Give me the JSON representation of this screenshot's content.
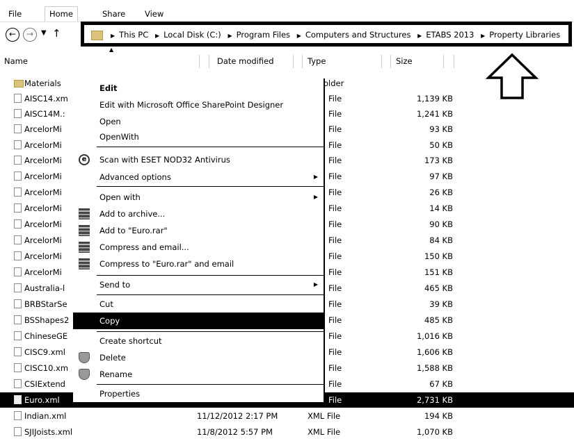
{
  "ribbon": {
    "tabs": [
      "File",
      "Home",
      "Share",
      "View"
    ]
  },
  "address": {
    "crumbs": [
      "This PC",
      "Local Disk (C:)",
      "Program Files",
      "Computers and Structures",
      "ETABS 2013",
      "Property Libraries"
    ]
  },
  "columns": {
    "name": "Name",
    "date": "Date modified",
    "type": "Type",
    "size": "Size"
  },
  "files": [
    {
      "name": "Materials",
      "date": "",
      "type": "older",
      "size": "",
      "folder": true
    },
    {
      "name": "AISC14.xm",
      "date": "",
      "type": "File",
      "size": "1,139 KB"
    },
    {
      "name": "AISC14M.:",
      "date": "",
      "type": "File",
      "size": "1,241 KB"
    },
    {
      "name": "ArcelorMi",
      "date": "",
      "type": "File",
      "size": "93 KB"
    },
    {
      "name": "ArcelorMi",
      "date": "",
      "type": "File",
      "size": "50 KB"
    },
    {
      "name": "ArcelorMi",
      "date": "",
      "type": "File",
      "size": "173 KB"
    },
    {
      "name": "ArcelorMi",
      "date": "",
      "type": "File",
      "size": "97 KB"
    },
    {
      "name": "ArcelorMi",
      "date": "",
      "type": "File",
      "size": "26 KB"
    },
    {
      "name": "ArcelorMi",
      "date": "",
      "type": "File",
      "size": "14 KB"
    },
    {
      "name": "ArcelorMi",
      "date": "",
      "type": "File",
      "size": "90 KB"
    },
    {
      "name": "ArcelorMi",
      "date": "",
      "type": "File",
      "size": "84 KB"
    },
    {
      "name": "ArcelorMi",
      "date": "",
      "type": "File",
      "size": "150 KB"
    },
    {
      "name": "ArcelorMi",
      "date": "",
      "type": "File",
      "size": "151 KB"
    },
    {
      "name": "Australia-l",
      "date": "",
      "type": "File",
      "size": "465 KB"
    },
    {
      "name": "BRBStarSe",
      "date": "",
      "type": "File",
      "size": "39 KB"
    },
    {
      "name": "BSShapes2",
      "date": "",
      "type": "File",
      "size": "485 KB"
    },
    {
      "name": "ChineseGE",
      "date": "",
      "type": "File",
      "size": "1,016 KB"
    },
    {
      "name": "CISC9.xml",
      "date": "",
      "type": "File",
      "size": "1,606 KB"
    },
    {
      "name": "CISC10.xm",
      "date": "",
      "type": "File",
      "size": "1,588 KB"
    },
    {
      "name": "CSIExtend",
      "date": "",
      "type": "File",
      "size": "67 KB"
    },
    {
      "name": "Euro.xml",
      "date": "",
      "type": "File",
      "size": "2,731 KB",
      "selected": true
    },
    {
      "name": "Indian.xml",
      "date": "11/12/2012 2:17 PM",
      "type": "XML File",
      "size": "194 KB"
    },
    {
      "name": "SJIJoists.xml",
      "date": "11/8/2012 5:57 PM",
      "type": "XML File",
      "size": "1,070 KB"
    }
  ],
  "menu": {
    "edit": "Edit",
    "edit_sharepoint": "Edit with Microsoft Office SharePoint Designer",
    "open": "Open",
    "openwith_plain": "OpenWith",
    "scan": "Scan with ESET NOD32 Antivirus",
    "advanced": "Advanced options",
    "open_with": "Open with",
    "add_archive": "Add to archive...",
    "add_rar": "Add to \"Euro.rar\"",
    "compress_email": "Compress and email...",
    "compress_rar_email": "Compress to \"Euro.rar\" and email",
    "send_to": "Send to",
    "cut": "Cut",
    "copy": "Copy",
    "create_shortcut": "Create shortcut",
    "delete": "Delete",
    "rename": "Rename",
    "properties": "Properties"
  },
  "icons": {
    "back": "back-arrow-icon",
    "forward": "forward-arrow-icon",
    "up": "up-arrow-icon",
    "annotation": "up-outline-arrow-icon"
  }
}
